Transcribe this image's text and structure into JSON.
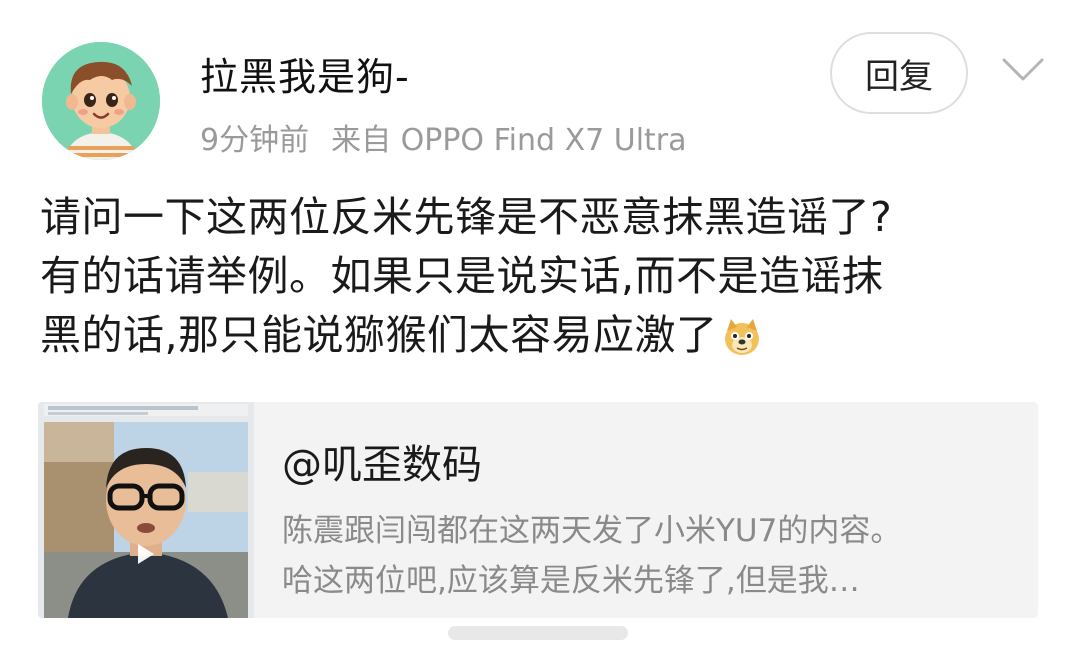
{
  "post": {
    "username": "拉黑我是狗-",
    "time": "9分钟前",
    "source": "来自 OPPO Find X7 Ultra",
    "reply_label": "回复",
    "text_lines": [
      "请问一下这两位反米先锋是不恶意抹黑造谣了?",
      "有的话请举例。如果只是说实话,而不是造谣抹",
      "黑的话,那只能说猕猴们太容易应激了"
    ]
  },
  "repost": {
    "title": "@叽歪数码",
    "desc_lines": [
      "陈震跟闫闯都在这两天发了小米YU7的内容。",
      "哈这两位吧,应该算是反米先锋了,但是我…"
    ]
  },
  "icons": {
    "avatar": "cartoon-boy-avatar",
    "more": "chevron-down-icon",
    "emoji": "doge-emoji",
    "play": "play-icon"
  },
  "colors": {
    "avatar_bg": "#7ad3b1",
    "meta_text": "#9a9a9a",
    "card_bg": "#f3f3f3"
  }
}
